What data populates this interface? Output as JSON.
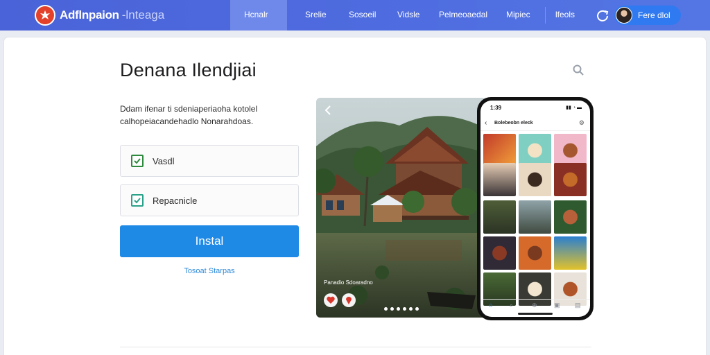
{
  "header": {
    "brand": "Adflnpaion",
    "brand_sub": "-lnteaga",
    "nav": [
      "Hcnalr",
      "Srelie",
      "Sosoeil",
      "Vidsle",
      "Pelmeoaedal",
      "Mipiec",
      "lfeols"
    ],
    "active_nav": "Hcnalr",
    "user_name": "Fere dlol"
  },
  "main": {
    "title": "Denana Ilendjiai",
    "description": "Ddam ifenar ti sdeniaperiaoha kotolel calhopeiacandehadlo Nonarahdoas.",
    "options": [
      {
        "label": "Vasdl",
        "checked": true
      },
      {
        "label": "Repacnicle",
        "checked": true
      }
    ],
    "install_label": "Instal",
    "secondary_link": "Tosoat Starpas"
  },
  "photo": {
    "caption": "Panadio Sdoaradno"
  },
  "phone": {
    "time": "1:39",
    "status": "▮▮ ◔ ▬",
    "app_title": "Bolebeobn eleck"
  },
  "colors": {
    "nav_bg": "#4a63d8",
    "nav_active": "#6f89ea",
    "accent": "#1f8ae6",
    "check_green": "#2e8b3e",
    "check_teal": "#2aa189"
  }
}
